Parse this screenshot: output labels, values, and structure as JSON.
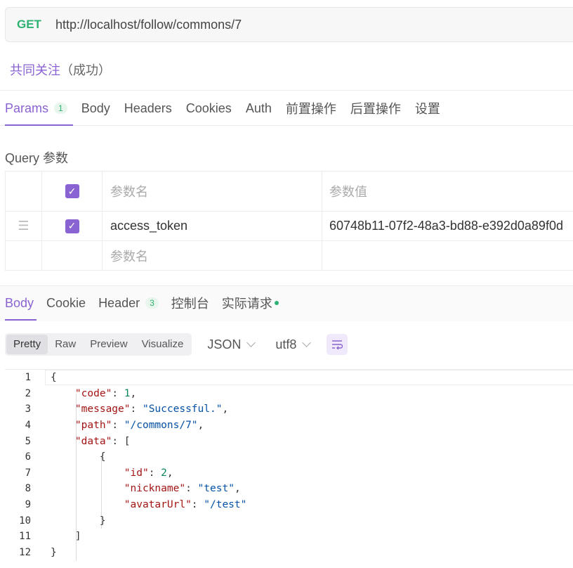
{
  "request": {
    "method": "GET",
    "url": "http://localhost/follow/commons/7"
  },
  "request_name": {
    "name": "共同关注",
    "status": "（成功）"
  },
  "request_tabs": [
    {
      "label": "Params",
      "badge": "1"
    },
    {
      "label": "Body"
    },
    {
      "label": "Headers"
    },
    {
      "label": "Cookies"
    },
    {
      "label": "Auth"
    },
    {
      "label": "前置操作"
    },
    {
      "label": "后置操作"
    },
    {
      "label": "设置"
    }
  ],
  "query": {
    "title": "Query 参数",
    "header": {
      "name_placeholder": "参数名",
      "value_placeholder": "参数值"
    },
    "rows": [
      {
        "name": "access_token",
        "value": "60748b11-07f2-48a3-bd88-e392d0a89f0d"
      }
    ],
    "empty_name_placeholder": "参数名"
  },
  "response_tabs": [
    {
      "label": "Body"
    },
    {
      "label": "Cookie"
    },
    {
      "label": "Header",
      "badge": "3"
    },
    {
      "label": "控制台"
    },
    {
      "label": "实际请求"
    }
  ],
  "view_modes": [
    "Pretty",
    "Raw",
    "Preview",
    "Visualize"
  ],
  "format": "JSON",
  "encoding": "utf8",
  "code": {
    "line_numbers": [
      "1",
      "2",
      "3",
      "4",
      "5",
      "6",
      "7",
      "8",
      "9",
      "10",
      "11",
      "12"
    ],
    "l1": "{",
    "code_key": "\"code\"",
    "code_val": "1",
    "message_key": "\"message\"",
    "message_val": "\"Successful.\"",
    "path_key": "\"path\"",
    "path_val": "\"/commons/7\"",
    "data_key": "\"data\"",
    "id_key": "\"id\"",
    "id_val": "2",
    "nickname_key": "\"nickname\"",
    "nickname_val": "\"test\"",
    "avatar_key": "\"avatarUrl\"",
    "avatar_val": "\"/test\""
  },
  "colors": {
    "accent": "#8a63d2",
    "success": "#2fb171"
  }
}
